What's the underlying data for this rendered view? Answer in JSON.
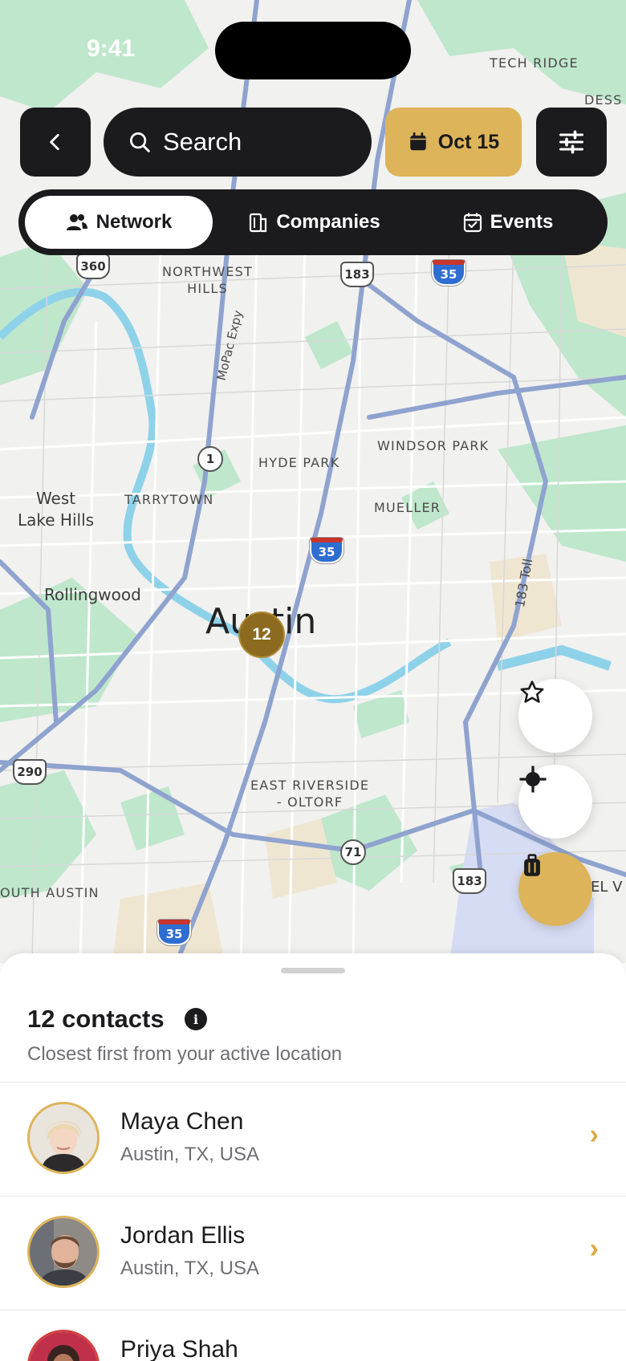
{
  "status": {
    "time": "9:41"
  },
  "header": {
    "search_placeholder": "Search",
    "date_label": "Oct 15"
  },
  "tabs": [
    {
      "label": "Network",
      "active": true
    },
    {
      "label": "Companies",
      "active": false
    },
    {
      "label": "Events",
      "active": false
    }
  ],
  "map": {
    "labels": {
      "tech_ridge": "TECH RIDGE",
      "dess": "DESS",
      "northwest_hills": "NORTHWEST\nHILLS",
      "mopac": "MoPac Expy",
      "hyde_park": "HYDE PARK",
      "windsor_park": "WINDSOR PARK",
      "tarrytown": "TARRYTOWN",
      "mueller": "MUELLER",
      "west_lake_hills": "West\nLake Hills",
      "rollingwood": "Rollingwood",
      "austin": "Austin",
      "east_riverside": "EAST RIVERSIDE\n- OLTORF",
      "south_austin": "OUTH AUSTIN",
      "toll_183": "183 Toll",
      "el_v": "EL V"
    },
    "shields": {
      "s360": "360",
      "s183a": "183",
      "s35a": "35",
      "s1": "1",
      "s35b": "35",
      "s290": "290",
      "s71": "71",
      "s183b": "183",
      "s35c": "35"
    },
    "cluster_count": "12"
  },
  "sheet": {
    "title": "12 contacts",
    "subtitle": "Closest first from your active location"
  },
  "contacts": [
    {
      "name": "Maya Chen",
      "location": "Austin, TX, USA"
    },
    {
      "name": "Jordan Ellis",
      "location": "Austin, TX, USA"
    },
    {
      "name": "Priya Shah",
      "location": ""
    }
  ],
  "colors": {
    "accent": "#ddb45a",
    "dark": "#1b1b1d",
    "cluster": "#8c6a1f",
    "park": "#b7e6c8",
    "water": "#8ed2ea"
  },
  "icons": {
    "back": "chevron-left-icon",
    "search": "search-icon",
    "calendar": "calendar-icon",
    "filter": "sliders-icon",
    "star": "star-icon",
    "locate": "crosshair-icon",
    "luggage": "luggage-icon"
  }
}
